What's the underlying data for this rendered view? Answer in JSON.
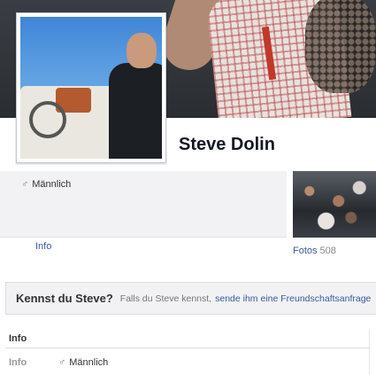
{
  "profile": {
    "name": "Steve Dolin",
    "gender": "Männlich",
    "gender_icon": "male-sign-icon"
  },
  "nav": {
    "info_link": "Info",
    "fotos_label": "Fotos",
    "fotos_count": "508"
  },
  "know_box": {
    "title": "Kennst du Steve?",
    "text": "Falls du Steve kennst,",
    "link": "sende ihm eine Freundschaftsanfrage"
  },
  "info_section": {
    "header": "Info",
    "row_label": "Info",
    "row_value": "Männlich"
  },
  "colors": {
    "link": "#3b5998",
    "panel_bg": "#f2f2f4"
  }
}
